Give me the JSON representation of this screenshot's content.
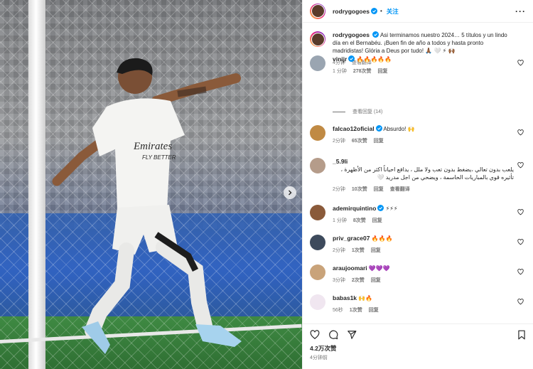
{
  "post": {
    "username": "rodrygogoes",
    "follow_label": "关注",
    "dot": "•",
    "caption": "Asi terminamos nuestro 2024… 5 títulos y un lindo día en el Bernabéu. ¡Buen fin de año a todos y hasta pronto madridistas! Glória a Deus por tudo! 🙏🏾 🤍 ⚡ 🙌🏾",
    "caption_time": "4分钟",
    "see_translation": "查看翻译",
    "likes": "4.2万次赞",
    "posted_time": "4分钟前"
  },
  "comments": [
    {
      "user": "vinijr",
      "verified": true,
      "text": "🔥🔥🔥🔥🔥",
      "time": "1 分钟",
      "likes": "278次赞",
      "reply": "回复",
      "extra": "",
      "avatar_color": "#9aa5b1"
    },
    {
      "user": "falcao12oficial",
      "verified": true,
      "text": "Absurdo! 🙌",
      "time": "2分钟",
      "likes": "65次赞",
      "reply": "回复",
      "extra": "",
      "avatar_color": "#c08a44"
    },
    {
      "user": "_5.9li",
      "verified": false,
      "text": "يلعب بدون تعالي ،يضغط بدون تعب ولا ملل ، يدافع احياناً اكثر من الأظهرة ، تأثيره قوي بالمباريات الحاسمة ، ويضحي من اجل مدريد 🤍",
      "time": "2分钟",
      "likes": "10次赞",
      "reply": "回复",
      "extra": "查看翻译",
      "avatar_color": "#b59c8a"
    },
    {
      "user": "ademirquintino",
      "verified": true,
      "text": "⚡⚡⚡",
      "time": "1 分钟",
      "likes": "8次赞",
      "reply": "回复",
      "extra": "",
      "avatar_color": "#8a5a3a"
    },
    {
      "user": "priv_grace07",
      "verified": false,
      "text": "🔥🔥🔥",
      "time": "2分钟",
      "likes": "1次赞",
      "reply": "回复",
      "extra": "",
      "avatar_color": "#3d4a5c"
    },
    {
      "user": "araujoomari",
      "verified": false,
      "text": "💜💜💜",
      "time": "3分钟",
      "likes": "2次赞",
      "reply": "回复",
      "extra": "",
      "avatar_color": "#c9a37a"
    },
    {
      "user": "babas1k",
      "verified": false,
      "text": "🙌🔥",
      "time": "56秒",
      "likes": "1次赞",
      "reply": "回复",
      "extra": "",
      "avatar_color": "#f0e6f0"
    }
  ],
  "view_replies": "查看回复 (14)",
  "colors": {
    "accent": "#0095f6",
    "verified": "#0095f6",
    "muted": "#737373"
  }
}
